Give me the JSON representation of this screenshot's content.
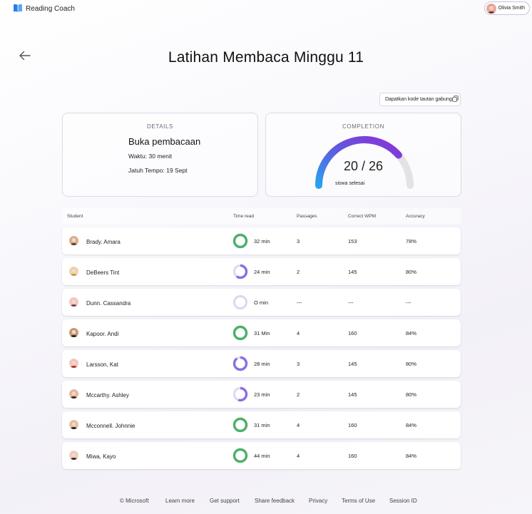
{
  "app": {
    "title": "Reading Coach"
  },
  "user": {
    "name": "Olivia Smith"
  },
  "page": {
    "title": "Latihan Membaca Minggu 11"
  },
  "join_button": {
    "label": "Dapatkan kode tautan gabungan"
  },
  "details": {
    "label": "DETAILS",
    "title": "Buka pembacaan",
    "time": "Waktu: 30 menit",
    "due": "Jatuh Tempo: 19 Sept"
  },
  "completion": {
    "label": "COMPLETION",
    "value": "20 / 26",
    "done": 20,
    "total": 26,
    "caption": "siswa selesai"
  },
  "table": {
    "headers": {
      "student": "Student",
      "time": "Time read",
      "passages": "Passages",
      "wpm": "Correct WPM",
      "accuracy": "Accuracy"
    },
    "rows": [
      {
        "name": "Brady. Amara",
        "time": "32 min",
        "progress": 1.0,
        "passages": "3",
        "wpm": "153",
        "accuracy": "78%",
        "ring_color": "#4caf6a"
      },
      {
        "name": "DeBeers Tint",
        "time": "24 min",
        "progress": 0.6,
        "passages": "2",
        "wpm": "145",
        "accuracy": "80%",
        "ring_color": "#8a6fe0"
      },
      {
        "name": "Dunn. Cassandra",
        "time": "O min",
        "progress": 0.0,
        "passages": "---",
        "wpm": "---",
        "accuracy": "---",
        "ring_color": "#8a6fe0"
      },
      {
        "name": "Kapoor. Andi",
        "time": "31 Min",
        "progress": 1.0,
        "passages": "4",
        "wpm": "160",
        "accuracy": "84%",
        "ring_color": "#4caf6a"
      },
      {
        "name": "Larsson, Kat",
        "time": "28 min",
        "progress": 0.9,
        "passages": "3",
        "wpm": "145",
        "accuracy": "80%",
        "ring_color": "#8a6fe0"
      },
      {
        "name": "Mccarthy. Ashley",
        "time": "23 min",
        "progress": 0.55,
        "passages": "2",
        "wpm": "145",
        "accuracy": "80%",
        "ring_color": "#8a6fe0"
      },
      {
        "name": "Mcconnell. Johnnie",
        "time": "31 min",
        "progress": 1.0,
        "passages": "4",
        "wpm": "160",
        "accuracy": "84%",
        "ring_color": "#4caf6a"
      },
      {
        "name": "Miwa, Kayo",
        "time": "44 min",
        "progress": 1.0,
        "passages": "4",
        "wpm": "160",
        "accuracy": "84%",
        "ring_color": "#4caf6a"
      }
    ]
  },
  "footer": {
    "links": [
      "© Microsoft",
      "Learn more",
      "Get support",
      "Share feedback",
      "Privacy",
      "Terms of Use",
      "Session ID"
    ]
  }
}
